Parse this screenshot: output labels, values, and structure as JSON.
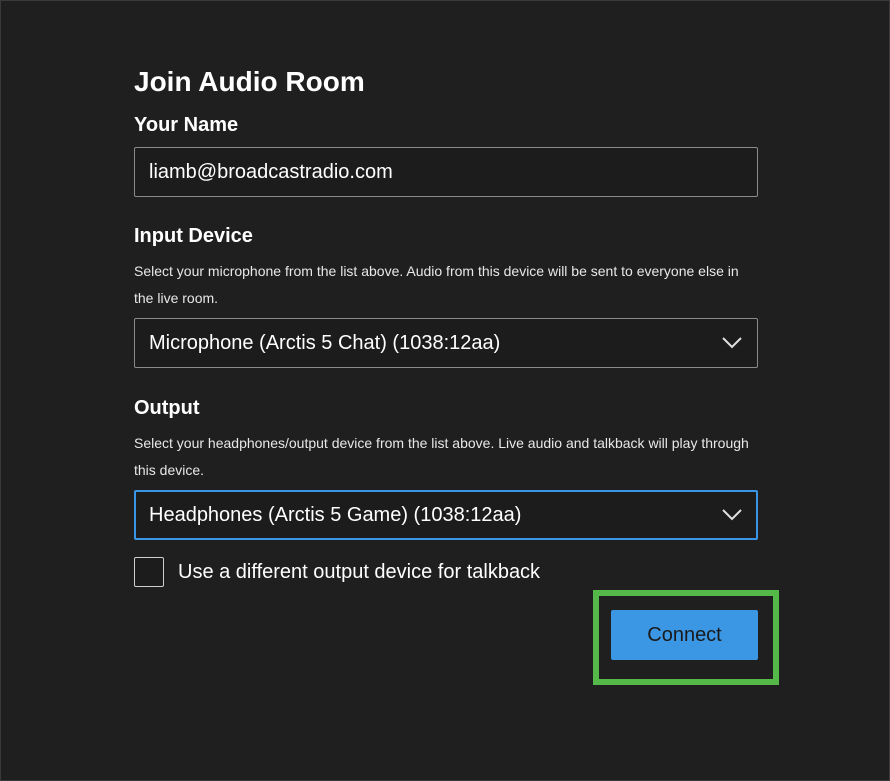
{
  "dialog": {
    "title": "Join Audio Room"
  },
  "name_field": {
    "label": "Your Name",
    "value": "liamb@broadcastradio.com"
  },
  "input_device": {
    "label": "Input Device",
    "help": "Select your microphone from the list above. Audio from this device will be sent to everyone else in the live room.",
    "selected": "Microphone (Arctis 5 Chat) (1038:12aa)"
  },
  "output_device": {
    "label": "Output",
    "help": "Select your headphones/output device from the list above. Live audio and talkback will play through this device.",
    "selected": "Headphones (Arctis 5 Game) (1038:12aa)"
  },
  "talkback_option": {
    "label": "Use a different output device for talkback",
    "checked": false
  },
  "actions": {
    "connect_label": "Connect"
  },
  "colors": {
    "background": "#1f1f1f",
    "accent": "#3b97e3",
    "focus_border": "#3b95e6",
    "highlight": "#54b948"
  },
  "icons": {
    "dropdown": "chevron-down-icon"
  }
}
